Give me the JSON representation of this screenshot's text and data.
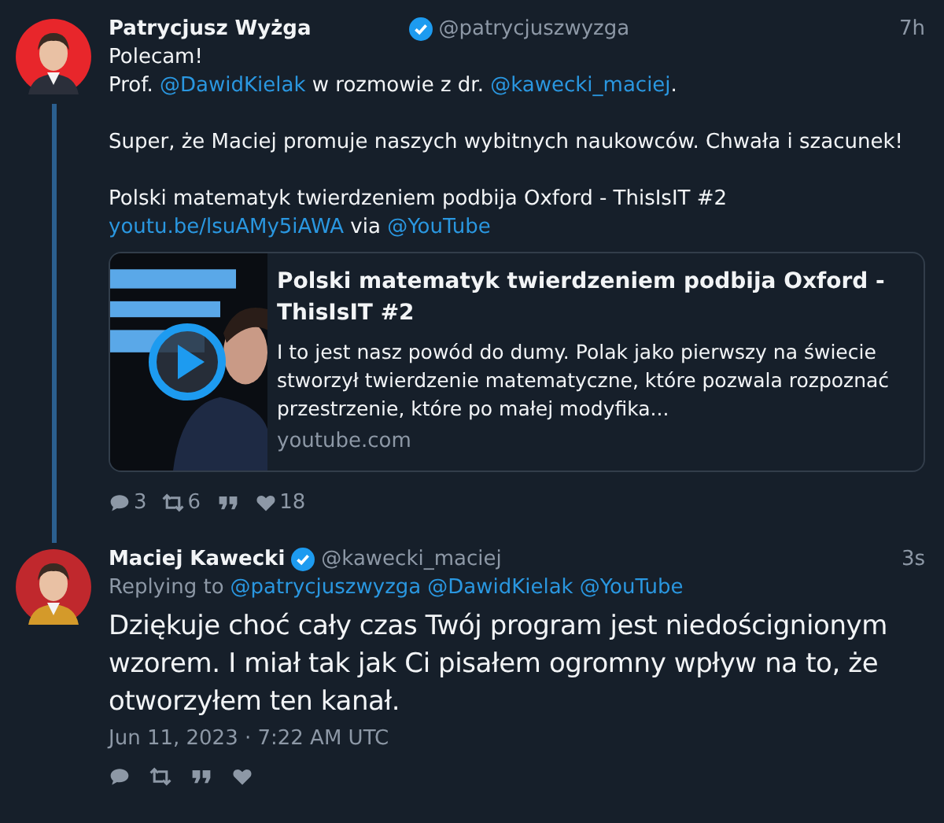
{
  "tweets": [
    {
      "kind": "thread",
      "author": {
        "name": "Patrycjusz Wyżga",
        "handle": "@patrycjuszwyzga",
        "verified": true
      },
      "time": "7h",
      "paragraphs": [
        [
          [
            {
              "text": "Polecam!",
              "link": false
            }
          ],
          [
            {
              "text": "Prof. ",
              "link": false
            },
            {
              "text": "@DawidKielak",
              "link": true
            },
            {
              "text": " w rozmowie z dr. ",
              "link": false
            },
            {
              "text": "@kawecki_maciej",
              "link": true
            },
            {
              "text": ".",
              "link": false
            }
          ]
        ],
        [
          [
            {
              "text": "Super, że Maciej promuje naszych wybitnych naukowców. Chwała i szacunek!",
              "link": false
            }
          ]
        ],
        [
          [
            {
              "text": "Polski matematyk twierdzeniem podbija Oxford - ThisIsIT #2",
              "link": false
            }
          ],
          [
            {
              "text": "youtu.be/lsuAMy5iAWA",
              "link": true
            },
            {
              "text": " via ",
              "link": false
            },
            {
              "text": "@YouTube",
              "link": true
            }
          ]
        ]
      ],
      "card": {
        "title": "Polski matematyk twierdzeniem podbija Oxford - ThisIsIT #2",
        "description": "I to jest nasz powód do dumy. Polak jako pierwszy na świecie stworzył twierdzenie matematyczne, które pozwala rozpoznać przestrzenie, które po małej modyfika...",
        "domain": "youtube.com"
      },
      "actions": [
        {
          "kind": "reply",
          "count": "3"
        },
        {
          "kind": "retweet",
          "count": "6"
        },
        {
          "kind": "quote"
        },
        {
          "kind": "like",
          "count": "18"
        }
      ]
    },
    {
      "kind": "focused",
      "author": {
        "name": "Maciej Kawecki",
        "handle": "@kawecki_maciej",
        "verified": true
      },
      "time": "3s",
      "replying_label": "Replying to",
      "replying_to": [
        "@patrycjuszwyzga",
        "@DawidKielak",
        "@YouTube"
      ],
      "paragraphs": [
        [
          [
            {
              "text": "Dziękuje choć cały czas Twój program jest niedoścignionym wzorem. I miał tak jak Ci pisałem ogromny wpływ na to, że otworzyłem ten kanał.",
              "link": false
            }
          ]
        ]
      ],
      "date": "Jun 11, 2023 · 7:22 AM UTC",
      "actions": [
        {
          "kind": "reply"
        },
        {
          "kind": "retweet"
        },
        {
          "kind": "quote"
        },
        {
          "kind": "like"
        }
      ]
    }
  ]
}
